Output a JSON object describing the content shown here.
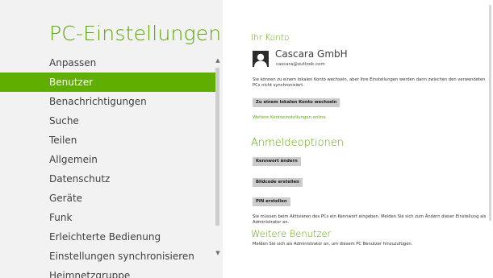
{
  "sidebar": {
    "title": "PC-Einstellungen",
    "items": [
      {
        "label": "Anpassen"
      },
      {
        "label": "Benutzer"
      },
      {
        "label": "Benachrichtigungen"
      },
      {
        "label": "Suche"
      },
      {
        "label": "Teilen"
      },
      {
        "label": "Allgemein"
      },
      {
        "label": "Datenschutz"
      },
      {
        "label": "Geräte"
      },
      {
        "label": "Funk"
      },
      {
        "label": "Erleichterte Bedienung"
      },
      {
        "label": "Einstellungen synchronisieren"
      },
      {
        "label": "Heimnetzgruppe"
      }
    ],
    "selected_index": 1
  },
  "account": {
    "section_title": "Ihr Konto",
    "name": "Cascara GmbH",
    "email": "cascara@outlook.com",
    "description": "Sie können zu einem lokalen Konto wechseln, aber Ihre Einstellungen werden dann zwischen den verwendeten PCs nicht synchronisiert.",
    "switch_button": "Zu einem lokalen Konto wechseln",
    "more_link": "Weitere Kontoeinstellungen online"
  },
  "signin": {
    "section_title": "Anmeldeoptionen",
    "change_password_button": "Kennwort ändern",
    "picture_password_button": "Bildcode erstellen",
    "pin_button": "PIN erstellen",
    "note": "Sie müssen beim Aktivieren des PCs ein Kennwort eingeben. Melden Sie sich zum Ändern dieser Einstellung als Administrator an."
  },
  "other_users": {
    "section_title": "Weitere Benutzer",
    "note": "Melden Sie sich als Administrator an, um diesem PC Benutzer hinzuzufügen."
  },
  "colors": {
    "accent": "#5aa800",
    "selected_background": "#5fae00",
    "sidebar_background": "#f2f2f2",
    "button_background": "#cccccc"
  }
}
